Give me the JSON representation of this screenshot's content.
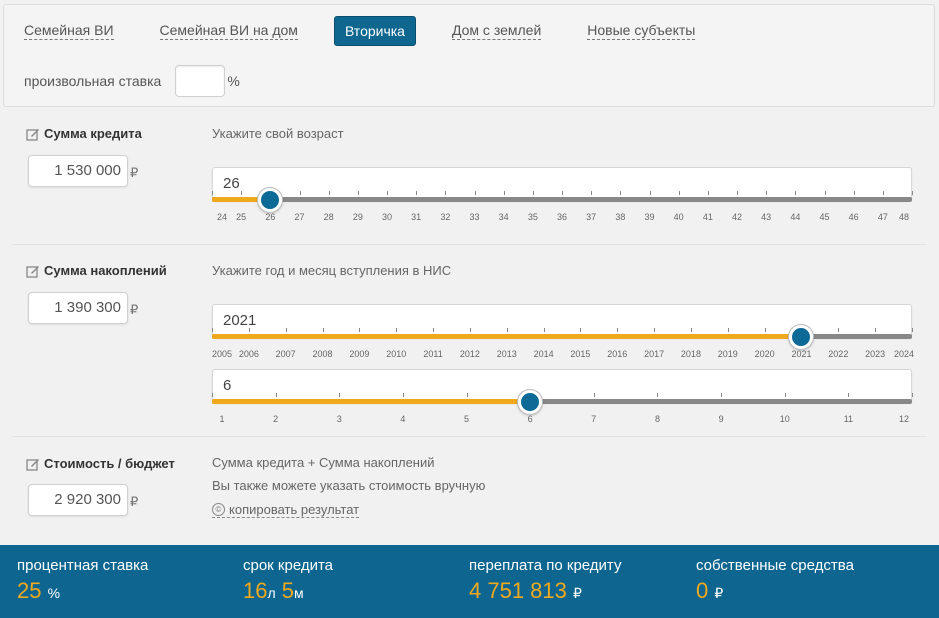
{
  "tabs": [
    {
      "label": "Семейная ВИ",
      "active": false
    },
    {
      "label": "Семейная ВИ на дом",
      "active": false
    },
    {
      "label": "Вторичка",
      "active": true
    },
    {
      "label": "Дом с землей",
      "active": false
    },
    {
      "label": "Новые субъекты",
      "active": false
    }
  ],
  "custom_rate": {
    "label": "произвольная ставка",
    "value": "",
    "unit": "%"
  },
  "currency": "₽",
  "loan": {
    "title": "Сумма кредита",
    "amount": "1 530 000",
    "hint": "Укажите свой возраст",
    "age": {
      "value": 26,
      "min": 24,
      "max": 48,
      "labels": [
        "24",
        "25",
        "26",
        "27",
        "28",
        "29",
        "30",
        "31",
        "32",
        "33",
        "34",
        "35",
        "36",
        "37",
        "38",
        "39",
        "40",
        "41",
        "42",
        "43",
        "44",
        "45",
        "46",
        "47",
        "48"
      ]
    }
  },
  "savings": {
    "title": "Сумма накоплений",
    "amount": "1 390 300",
    "hint": "Укажите год и месяц вступления в НИС",
    "year": {
      "value": 2021,
      "min": 2005,
      "max": 2024,
      "labels": [
        "2005",
        "2006",
        "2007",
        "2008",
        "2009",
        "2010",
        "2011",
        "2012",
        "2013",
        "2014",
        "2015",
        "2016",
        "2017",
        "2018",
        "2019",
        "2020",
        "2021",
        "2022",
        "2023",
        "2024"
      ]
    },
    "month": {
      "value": 6,
      "min": 1,
      "max": 12,
      "labels": [
        "1",
        "2",
        "3",
        "4",
        "5",
        "6",
        "7",
        "8",
        "9",
        "10",
        "11",
        "12"
      ]
    }
  },
  "budget": {
    "title": "Стоимость / бюджет",
    "amount": "2 920 300",
    "line1": "Сумма кредита + Сумма накоплений",
    "line2": "Вы также можете указать стоимость вручную",
    "copy_label": "копировать результат",
    "copy_icon": "copyright-icon"
  },
  "results": {
    "rate": {
      "label": "процентная ставка",
      "value": "25",
      "unit": "%"
    },
    "term": {
      "label": "срок кредита",
      "years": "16",
      "years_unit": "л",
      "months": "5",
      "months_unit": "м"
    },
    "overpay": {
      "label": "переплата по кредиту",
      "value": "4 751 813",
      "unit": "₽"
    },
    "own": {
      "label": "собственные средства",
      "value": "0",
      "unit": "₽"
    }
  },
  "colors": {
    "accent": "#f0a91c",
    "primary": "#0e6690"
  }
}
